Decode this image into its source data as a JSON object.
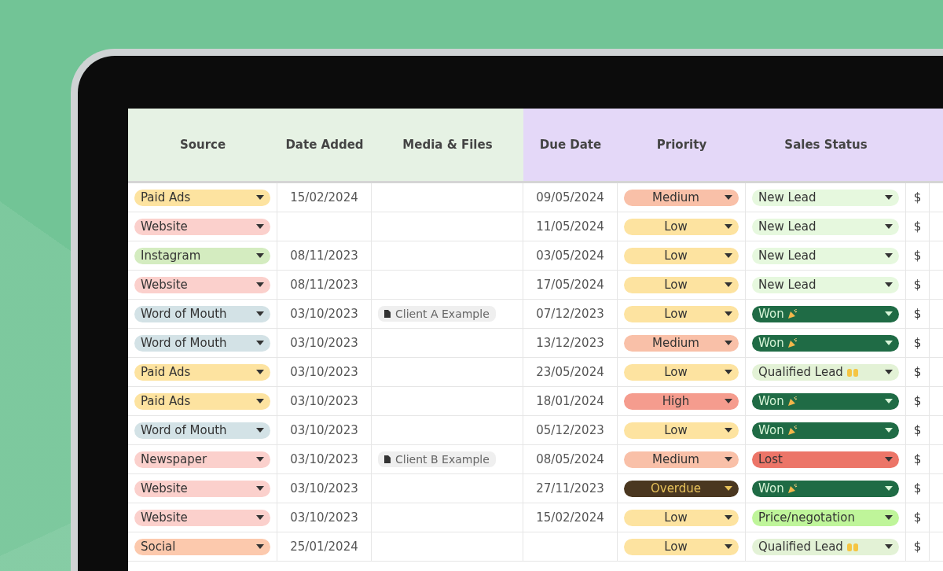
{
  "table": {
    "columns": [
      {
        "label": "Source",
        "color": "#e6f2e4"
      },
      {
        "label": "Date Added",
        "color": "#e6f2e4"
      },
      {
        "label": "Media & Files",
        "color": "#e6f2e4"
      },
      {
        "label": "Due Date",
        "color": "#e4d8f8"
      },
      {
        "label": "Priority",
        "color": "#e4d8f8"
      },
      {
        "label": "Sales Status",
        "color": "#e4d8f8"
      }
    ],
    "rows": [
      {
        "source": {
          "label": "Paid Ads",
          "color": "#fde3a0"
        },
        "date_added": "15/02/2024",
        "due_date": "09/05/2024",
        "priority": {
          "label": "Medium",
          "color": "#f9c0a8"
        },
        "status": {
          "label": "New Lead",
          "color": "#e6f8de"
        },
        "amount": "$"
      },
      {
        "source": {
          "label": "Website",
          "color": "#fbd0cc"
        },
        "due_date": "11/05/2024",
        "priority": {
          "label": "Low",
          "color": "#fde3a0"
        },
        "status": {
          "label": "New Lead",
          "color": "#e6f8de"
        },
        "amount": "$"
      },
      {
        "source": {
          "label": "Instagram",
          "color": "#d4ecc0"
        },
        "date_added": "08/11/2023",
        "due_date": "03/05/2024",
        "priority": {
          "label": "Low",
          "color": "#fde3a0"
        },
        "status": {
          "label": "New Lead",
          "color": "#e6f8de"
        },
        "amount": "$"
      },
      {
        "source": {
          "label": "Website",
          "color": "#fbd0cc"
        },
        "date_added": "08/11/2023",
        "due_date": "17/05/2024",
        "priority": {
          "label": "Low",
          "color": "#fde3a0"
        },
        "status": {
          "label": "New Lead",
          "color": "#e6f8de"
        },
        "amount": "$"
      },
      {
        "source": {
          "label": "Word of Mouth",
          "color": "#d3e2e6"
        },
        "date_added": "03/10/2023",
        "media": "Client A Example",
        "due_date": "07/12/2023",
        "priority": {
          "label": "Low",
          "color": "#fde3a0"
        },
        "status": {
          "label": "Won",
          "color": "#1f6b45",
          "kind": "won"
        },
        "amount": "$"
      },
      {
        "source": {
          "label": "Word of Mouth",
          "color": "#d3e2e6"
        },
        "date_added": "03/10/2023",
        "due_date": "13/12/2023",
        "priority": {
          "label": "Medium",
          "color": "#f9c0a8"
        },
        "status": {
          "label": "Won",
          "color": "#1f6b45",
          "kind": "won"
        },
        "amount": "$"
      },
      {
        "source": {
          "label": "Paid Ads",
          "color": "#fde3a0"
        },
        "date_added": "03/10/2023",
        "due_date": "23/05/2024",
        "priority": {
          "label": "Low",
          "color": "#fde3a0"
        },
        "status": {
          "label": "Qualified Lead",
          "color": "#e3f2d6",
          "kind": "qualified"
        },
        "amount": "$"
      },
      {
        "source": {
          "label": "Paid Ads",
          "color": "#fde3a0"
        },
        "date_added": "03/10/2023",
        "due_date": "18/01/2024",
        "priority": {
          "label": "High",
          "color": "#f59c8e"
        },
        "status": {
          "label": "Won",
          "color": "#1f6b45",
          "kind": "won"
        },
        "amount": "$"
      },
      {
        "source": {
          "label": "Word of Mouth",
          "color": "#d3e2e6"
        },
        "date_added": "03/10/2023",
        "due_date": "05/12/2023",
        "priority": {
          "label": "Low",
          "color": "#fde3a0"
        },
        "status": {
          "label": "Won",
          "color": "#1f6b45",
          "kind": "won"
        },
        "amount": "$"
      },
      {
        "source": {
          "label": "Newspaper",
          "color": "#fbd0cc"
        },
        "date_added": "03/10/2023",
        "media": "Client B Example",
        "due_date": "08/05/2024",
        "priority": {
          "label": "Medium",
          "color": "#f9c0a8"
        },
        "status": {
          "label": "Lost",
          "color": "#ec7568"
        },
        "amount": "$"
      },
      {
        "source": {
          "label": "Website",
          "color": "#fbd0cc"
        },
        "date_added": "03/10/2023",
        "due_date": "27/11/2023",
        "priority": {
          "label": "Overdue",
          "color": "#4a3720"
        },
        "status": {
          "label": "Won",
          "color": "#1f6b45",
          "kind": "won"
        },
        "amount": "$"
      },
      {
        "source": {
          "label": "Website",
          "color": "#fbd0cc"
        },
        "date_added": "03/10/2023",
        "due_date": "15/02/2024",
        "priority": {
          "label": "Low",
          "color": "#fde3a0"
        },
        "status": {
          "label": "Price/negotation",
          "color": "#bff59a"
        },
        "amount": "$"
      },
      {
        "source": {
          "label": "Social",
          "color": "#fcc9ad"
        },
        "date_added": "25/01/2024",
        "priority": {
          "label": "Low",
          "color": "#fde3a0"
        },
        "status": {
          "label": "Qualified Lead",
          "color": "#e3f2d6",
          "kind": "qualified"
        },
        "amount": "$"
      }
    ]
  }
}
